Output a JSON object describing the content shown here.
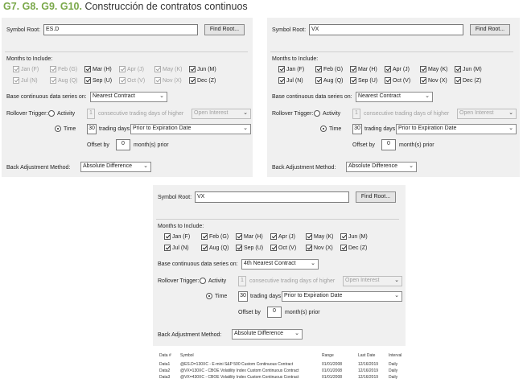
{
  "header": {
    "ref": "G7. G8. G9. G10.",
    "title": "Construcción de contratos continuos"
  },
  "labels": {
    "symbol_root": "Symbol Root:",
    "find_root": "Find Root...",
    "months_to_include": "Months to Include:",
    "base_series": "Base continuous data series on:",
    "rollover_trigger": "Rollover Trigger:",
    "activity": "Activity",
    "consecutive": "consecutive trading days of higher",
    "time": "Time",
    "trading_days": "trading days",
    "offset_by": "Offset by",
    "months_prior": "month(s) prior",
    "back_adjustment": "Back Adjustment Method:"
  },
  "panels": [
    {
      "symbol": "ES.D",
      "months": [
        {
          "label": "Jan (F)",
          "checked": true,
          "disabled": true
        },
        {
          "label": "Feb (G)",
          "checked": true,
          "disabled": true
        },
        {
          "label": "Mar (H)",
          "checked": true,
          "disabled": false
        },
        {
          "label": "Apr (J)",
          "checked": true,
          "disabled": true
        },
        {
          "label": "May (K)",
          "checked": true,
          "disabled": true
        },
        {
          "label": "Jun (M)",
          "checked": true,
          "disabled": false
        },
        {
          "label": "Jul (N)",
          "checked": true,
          "disabled": true
        },
        {
          "label": "Aug (Q)",
          "checked": true,
          "disabled": true
        },
        {
          "label": "Sep (U)",
          "checked": true,
          "disabled": false
        },
        {
          "label": "Oct (V)",
          "checked": true,
          "disabled": true
        },
        {
          "label": "Nov (X)",
          "checked": true,
          "disabled": true
        },
        {
          "label": "Dec (Z)",
          "checked": true,
          "disabled": false
        }
      ],
      "base_series_value": "Nearest Contract",
      "activity_days": "1",
      "activity_measure": "Open Interest",
      "time_days": "30",
      "time_basis": "Prior to Expiration Date",
      "offset_months": "0",
      "back_adjustment_value": "Absolute Difference"
    },
    {
      "symbol": "VX",
      "months": [
        {
          "label": "Jan (F)",
          "checked": true,
          "disabled": false
        },
        {
          "label": "Feb (G)",
          "checked": true,
          "disabled": false
        },
        {
          "label": "Mar (H)",
          "checked": true,
          "disabled": false
        },
        {
          "label": "Apr (J)",
          "checked": true,
          "disabled": false
        },
        {
          "label": "May (K)",
          "checked": true,
          "disabled": false
        },
        {
          "label": "Jun (M)",
          "checked": true,
          "disabled": false
        },
        {
          "label": "Jul (N)",
          "checked": true,
          "disabled": false
        },
        {
          "label": "Aug (Q)",
          "checked": true,
          "disabled": false
        },
        {
          "label": "Sep (U)",
          "checked": true,
          "disabled": false
        },
        {
          "label": "Oct (V)",
          "checked": true,
          "disabled": false
        },
        {
          "label": "Nov (X)",
          "checked": true,
          "disabled": false
        },
        {
          "label": "Dec (Z)",
          "checked": true,
          "disabled": false
        }
      ],
      "base_series_value": "Nearest Contract",
      "activity_days": "1",
      "activity_measure": "Open Interest",
      "time_days": "30",
      "time_basis": "Prior to Expiration Date",
      "offset_months": "0",
      "back_adjustment_value": "Absolute Difference"
    },
    {
      "symbol": "VX",
      "months": [
        {
          "label": "Jan (F)",
          "checked": true,
          "disabled": false
        },
        {
          "label": "Feb (G)",
          "checked": true,
          "disabled": false
        },
        {
          "label": "Mar (H)",
          "checked": true,
          "disabled": false
        },
        {
          "label": "Apr (J)",
          "checked": true,
          "disabled": false
        },
        {
          "label": "May (K)",
          "checked": true,
          "disabled": false
        },
        {
          "label": "Jun (M)",
          "checked": true,
          "disabled": false
        },
        {
          "label": "Jul (N)",
          "checked": true,
          "disabled": false
        },
        {
          "label": "Aug (Q)",
          "checked": true,
          "disabled": false
        },
        {
          "label": "Sep (U)",
          "checked": true,
          "disabled": false
        },
        {
          "label": "Oct (V)",
          "checked": true,
          "disabled": false
        },
        {
          "label": "Nov (X)",
          "checked": true,
          "disabled": false
        },
        {
          "label": "Dec (Z)",
          "checked": true,
          "disabled": false
        }
      ],
      "base_series_value": "4th Nearest Contract",
      "activity_days": "1",
      "activity_measure": "Open Interest",
      "time_days": "30",
      "time_basis": "Prior to Expiration Date",
      "offset_months": "0",
      "back_adjustment_value": "Absolute Difference"
    }
  ],
  "data_table": {
    "headers": [
      "Data #",
      "Symbol",
      "Range",
      "Last Date",
      "Interval"
    ],
    "rows": [
      [
        "Data1",
        "@ES.D=130XC - E-mini S&P 500 Custom Continuous Contract",
        "01/01/2008",
        "12/16/2019",
        "Daily"
      ],
      [
        "Data2",
        "@VX=130XC - CBOE Volatility Index Custom Continuous Contract",
        "01/01/2008",
        "12/16/2019",
        "Daily"
      ],
      [
        "Data3",
        "@VX=430XC - CBOE Volatility Index Custom Continuous Contract",
        "01/01/2008",
        "12/16/2019",
        "Daily"
      ]
    ]
  },
  "colors": {
    "accent": "#7aa84a",
    "panel_bg": "#f0f0f0"
  }
}
